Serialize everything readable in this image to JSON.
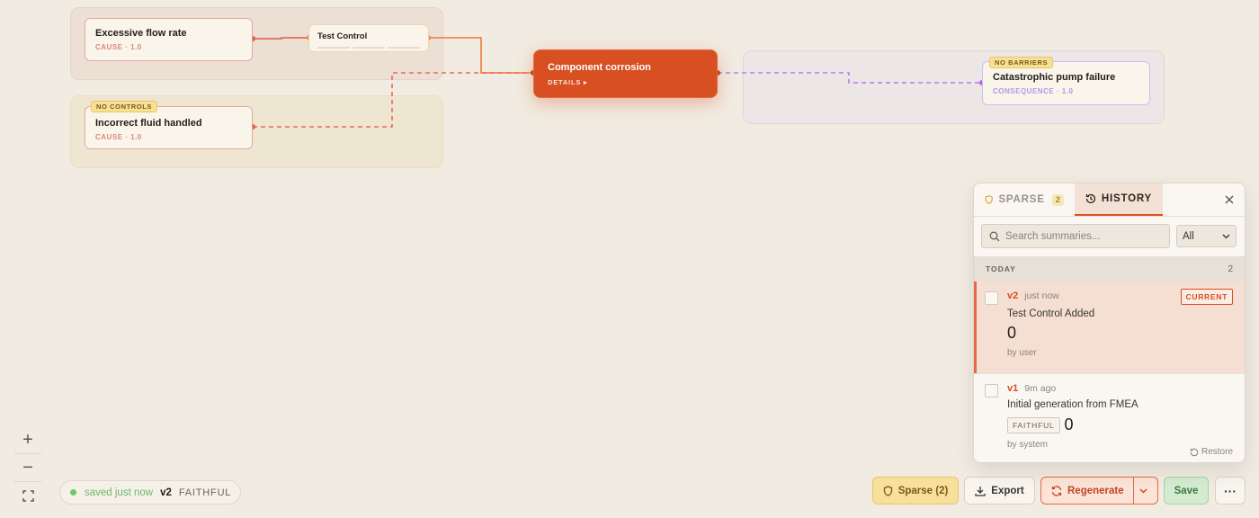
{
  "nodes": {
    "cause1": {
      "title": "Excessive flow rate",
      "sub": "CAUSE · 1.0"
    },
    "control": {
      "title": "Test Control"
    },
    "cause2": {
      "badge": "NO CONTROLS",
      "title": "Incorrect fluid handled",
      "sub": "CAUSE · 1.0"
    },
    "event": {
      "title": "Component corrosion",
      "sub": "DETAILS ▸"
    },
    "consequence": {
      "badge": "NO BARRIERS",
      "title": "Catastrophic pump failure",
      "sub": "CONSEQUENCE · 1.0"
    }
  },
  "zoom": {
    "in": "+",
    "out": "−",
    "fit_icon": "fit-screen-icon"
  },
  "status": {
    "saved": "saved just now",
    "version": "v2",
    "mode": "FAITHFUL"
  },
  "toolbar": {
    "sparse": "Sparse (2)",
    "export": "Export",
    "regenerate": "Regenerate",
    "save": "Save",
    "more": "···"
  },
  "panel": {
    "tabs": [
      {
        "label": "SPARSE",
        "count": "2"
      },
      {
        "label": "HISTORY"
      }
    ],
    "search_placeholder": "Search summaries...",
    "filter": "All",
    "section": {
      "label": "TODAY",
      "count": "2"
    },
    "entries": [
      {
        "version": "v2",
        "when": "just now",
        "badge": "CURRENT",
        "summary": "Test Control Added",
        "value": "0",
        "by": "by user"
      },
      {
        "version": "v1",
        "when": "9m ago",
        "summary": "Initial generation from FMEA",
        "tag": "FAITHFUL",
        "value": "0",
        "by": "by system",
        "restore": "Restore"
      }
    ]
  },
  "colors": {
    "accent": "#d84f22",
    "cause": "#e8a6a0",
    "consequence": "#b395ea",
    "control": "#f08a3c"
  }
}
